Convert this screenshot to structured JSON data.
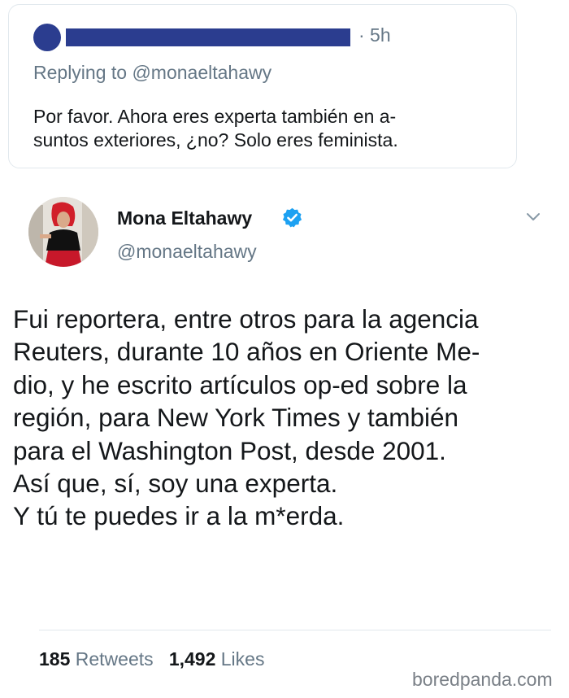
{
  "colors": {
    "censor": "#2b3d8f",
    "verified": "#1da1f2",
    "muted": "#657786"
  },
  "reply": {
    "time": "· 5h",
    "replying_to": "Replying to @monaeltahawy",
    "text": "Por favor. Ahora eres experta también en a-suntos exteriores, ¿no? Solo eres feminista."
  },
  "tweet": {
    "author_name": "Mona Eltahawy",
    "handle": "@monaeltahawy",
    "verified_icon": "verified-badge-icon",
    "menu_icon": "chevron-down-icon",
    "lines": [
      "Fui reportera, entre otros para la agencia",
      "Reuters, durante 10 años en Oriente Me-",
      "dio, y he escrito artículos op-ed sobre la",
      "región, para New York Times y también",
      "para el Washington Post, desde 2001.",
      "Así que, sí, soy una experta.",
      "Y tú te puedes ir a la m*erda."
    ],
    "stats": {
      "retweets_count": "185",
      "retweets_label": "Retweets",
      "likes_count": "1,492",
      "likes_label": "Likes"
    }
  },
  "watermark": "boredpanda.com"
}
